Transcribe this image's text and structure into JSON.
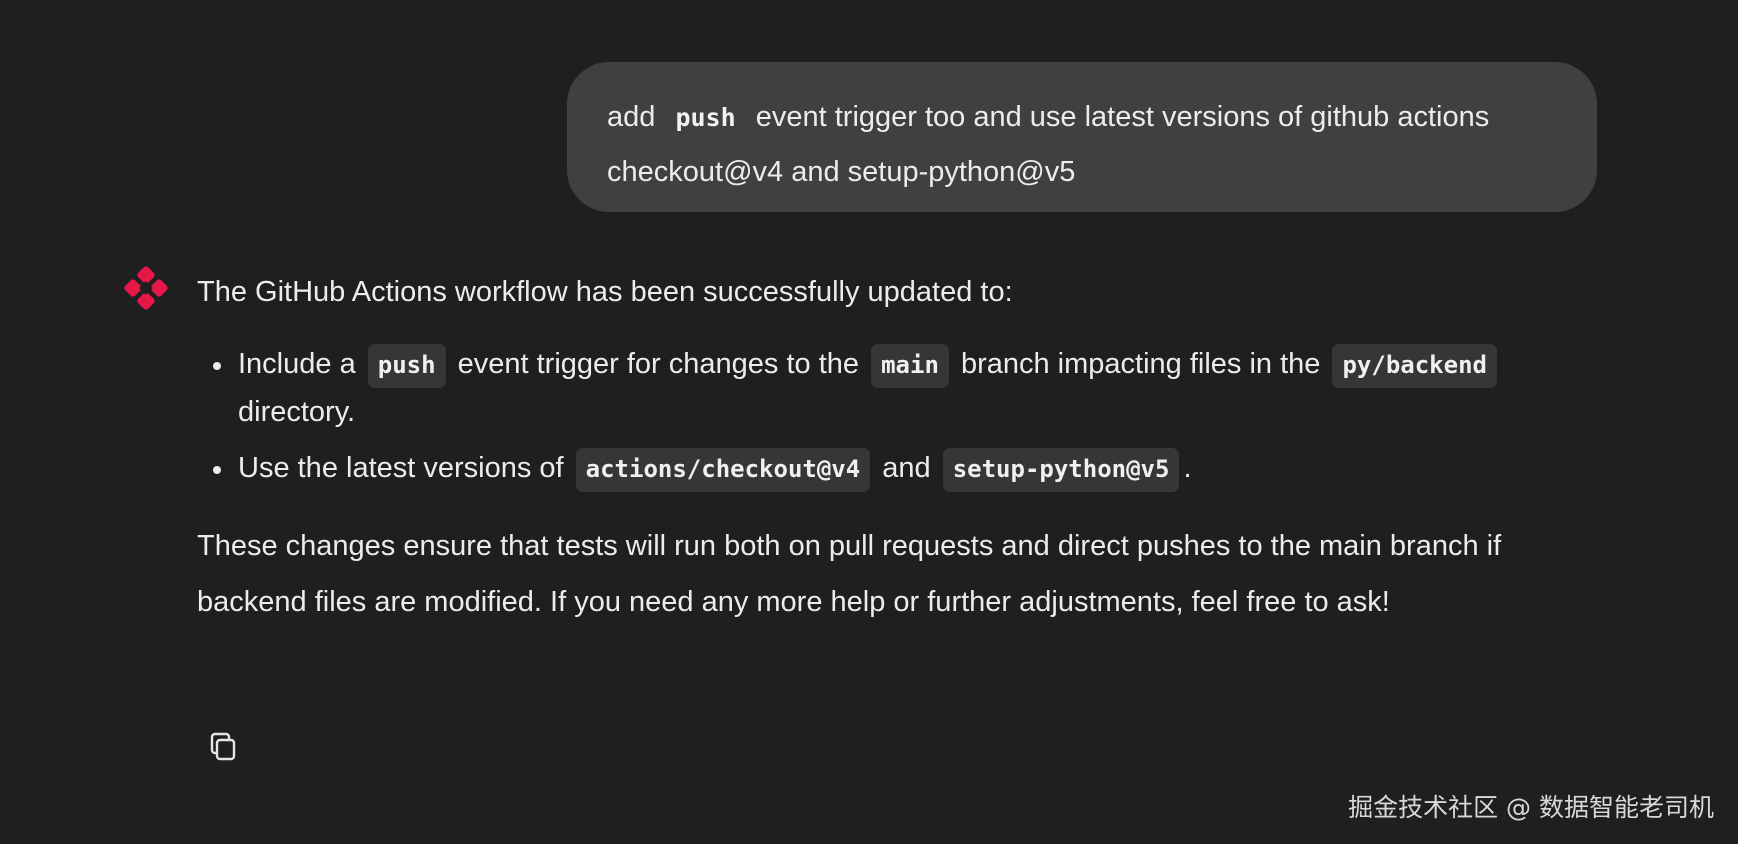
{
  "user_message": {
    "text_before": "add ",
    "code": "push",
    "text_after": " event trigger too and use latest versions of github actions checkout@v4 and setup-python@v5"
  },
  "assistant": {
    "logo_icon": "red-sparkle-logo-icon",
    "accent_color": "#e8174a",
    "intro": "The GitHub Actions workflow has been successfully updated to:",
    "bullet1": {
      "t1": "Include a ",
      "c1": "push",
      "t2": " event trigger for changes to the ",
      "c2": "main",
      "t3": " branch impacting files in the ",
      "c3": "py/backend",
      "t4": " directory."
    },
    "bullet2": {
      "t1": "Use the latest versions of ",
      "c1": "actions/checkout@v4",
      "t2": " and ",
      "c2": "setup-python@v5",
      "t3": "."
    },
    "summary": "These changes ensure that tests will run both on pull requests and direct pushes to the main branch if backend files are modified. If you need any more help or further adjustments, feel free to ask!",
    "copy_icon": "copy-icon"
  },
  "watermark": "掘金技术社区 @ 数据智能老司机"
}
